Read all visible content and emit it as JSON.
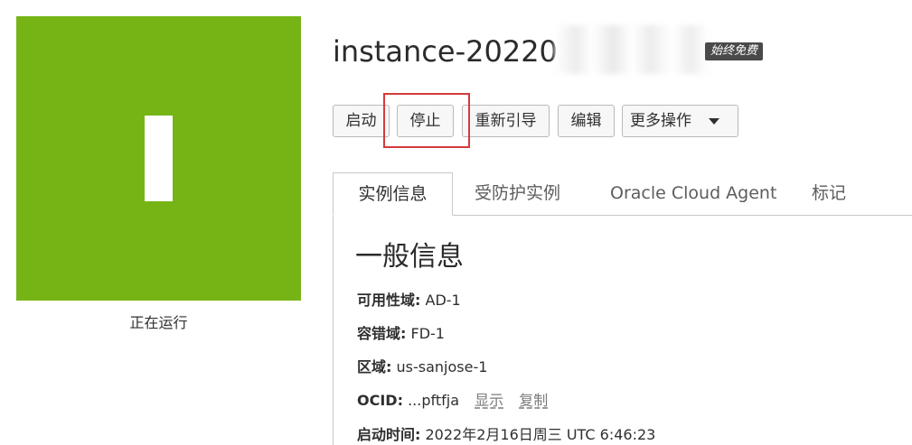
{
  "status": {
    "label": "正在运行",
    "color": "#76b416"
  },
  "instance": {
    "title_visible": "instance-202202",
    "badge": "始终免费"
  },
  "toolbar": {
    "buttons": [
      {
        "label": "启动"
      },
      {
        "label": "停止"
      },
      {
        "label": "重新引导"
      },
      {
        "label": "编辑"
      },
      {
        "label": "更多操作",
        "icon": "chevron-down-icon"
      }
    ],
    "highlighted_button": "停止",
    "highlight_color": "#d33b3b"
  },
  "tabs": {
    "items": [
      {
        "label": "实例信息",
        "active": true
      },
      {
        "label": "受防护实例",
        "active": false
      },
      {
        "label": "Oracle Cloud Agent",
        "active": false
      },
      {
        "label": "标记",
        "active": false
      }
    ]
  },
  "general_info": {
    "title": "一般信息",
    "rows": [
      {
        "key": "可用性域:",
        "value": "AD-1"
      },
      {
        "key": "容错域:",
        "value": "FD-1"
      },
      {
        "key": "区域:",
        "value": "us-sanjose-1"
      },
      {
        "key": "OCID:",
        "value": "...pftfja",
        "links": [
          "显示",
          "复制"
        ]
      },
      {
        "key": "启动时间:",
        "value": "2022年2月16日周三 UTC 6:46:23"
      }
    ]
  }
}
